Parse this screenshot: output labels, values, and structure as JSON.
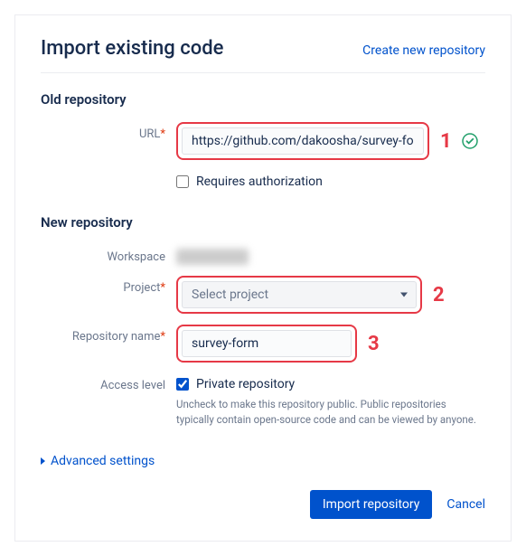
{
  "header": {
    "title": "Import existing code",
    "create_link": "Create new repository"
  },
  "old_repo": {
    "section_title": "Old repository",
    "url_label": "URL",
    "url_value": "https://github.com/dakoosha/survey-form",
    "requires_auth_label": "Requires authorization"
  },
  "new_repo": {
    "section_title": "New repository",
    "workspace_label": "Workspace",
    "project_label": "Project",
    "project_placeholder": "Select project",
    "repo_name_label": "Repository name",
    "repo_name_value": "survey-form",
    "access_label": "Access level",
    "private_label": "Private repository",
    "private_help": "Uncheck to make this repository public. Public repositories typically contain open-source code and can be viewed by anyone."
  },
  "advanced_label": "Advanced settings",
  "footer": {
    "import_btn": "Import repository",
    "cancel_btn": "Cancel"
  },
  "annotations": {
    "a1": "1",
    "a2": "2",
    "a3": "3"
  }
}
